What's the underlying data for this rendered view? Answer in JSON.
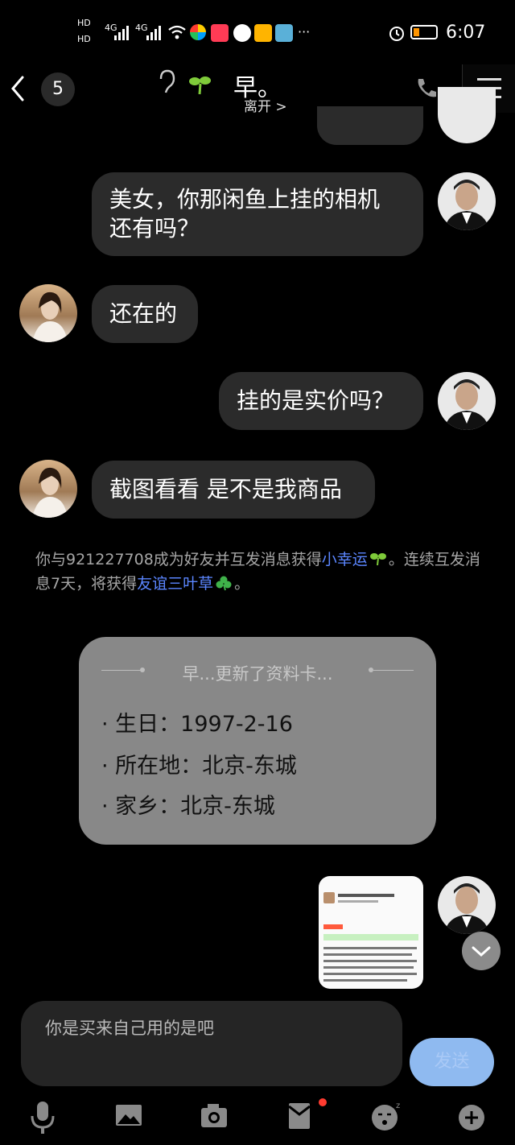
{
  "status_bar": {
    "time": "6:07",
    "hd1": "HD",
    "hd2": "HD",
    "net1": "4G",
    "net2": "4G",
    "more": "···"
  },
  "header": {
    "badge_count": "5",
    "title": "早。",
    "subtitle": "离开 >"
  },
  "messages": [
    {
      "from": "me",
      "text_line1": "美女，你那闲鱼上挂的相机",
      "text_line2": "还有吗？"
    },
    {
      "from": "other",
      "text": "还在的"
    },
    {
      "from": "me",
      "text": "挂的是实价吗？"
    },
    {
      "from": "other",
      "text": "截图看看 是不是我商品"
    }
  ],
  "system_message": {
    "part1": "你与921227708成为好友并互发消息获得",
    "link1": "小幸运",
    "part2": "。连续互发消息7天，将获得",
    "link2": "友谊三叶草",
    "part3": "。"
  },
  "profile_card": {
    "title": "早...更新了资料卡...",
    "lines": [
      "· 生日：1997-2-16",
      "· 所在地：北京-东城",
      "· 家乡：北京-东城"
    ]
  },
  "input": {
    "value": "你是买来自己用的是吧",
    "send_label": "发送"
  },
  "colors": {
    "background": "#000000",
    "bubble": "#2b2b2b",
    "link": "#5b86ff",
    "card": "#888888",
    "send": "#8fbaf0"
  },
  "toolbar": {
    "icons": [
      "microphone-icon",
      "image-icon",
      "camera-icon",
      "red-packet-icon",
      "emoji-icon",
      "plus-icon"
    ]
  }
}
